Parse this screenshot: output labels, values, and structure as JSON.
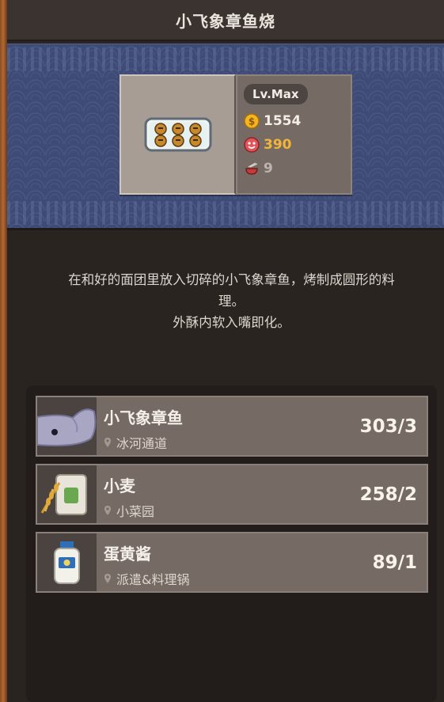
{
  "header": {
    "title": "小飞象章鱼烧"
  },
  "dish": {
    "level": "Lv.Max",
    "gold": "1554",
    "fans": "390",
    "time": "9",
    "icons": {
      "gold": "gold-coin-icon",
      "fans": "fan-face-icon",
      "time": "bowl-icon",
      "dish": "takoyaki-plate-icon"
    },
    "colors": {
      "fans": "#f2b53a",
      "banner": "#3e4b77"
    }
  },
  "description": {
    "line1": "在和好的面团里放入切碎的小飞象章鱼，烤制成圆形的料",
    "line2": "理。",
    "line3": "外酥内软入嘴即化。"
  },
  "ingredients": [
    {
      "name": "小飞象章鱼",
      "location": "冰河通道",
      "count": "303/3",
      "icon": "dumbo-octopus-icon"
    },
    {
      "name": "小麦",
      "location": "小菜园",
      "count": "258/2",
      "icon": "wheat-sack-icon"
    },
    {
      "name": "蛋黄酱",
      "location": "派遣&料理锅",
      "count": "89/1",
      "icon": "mayonnaise-jar-icon"
    }
  ]
}
